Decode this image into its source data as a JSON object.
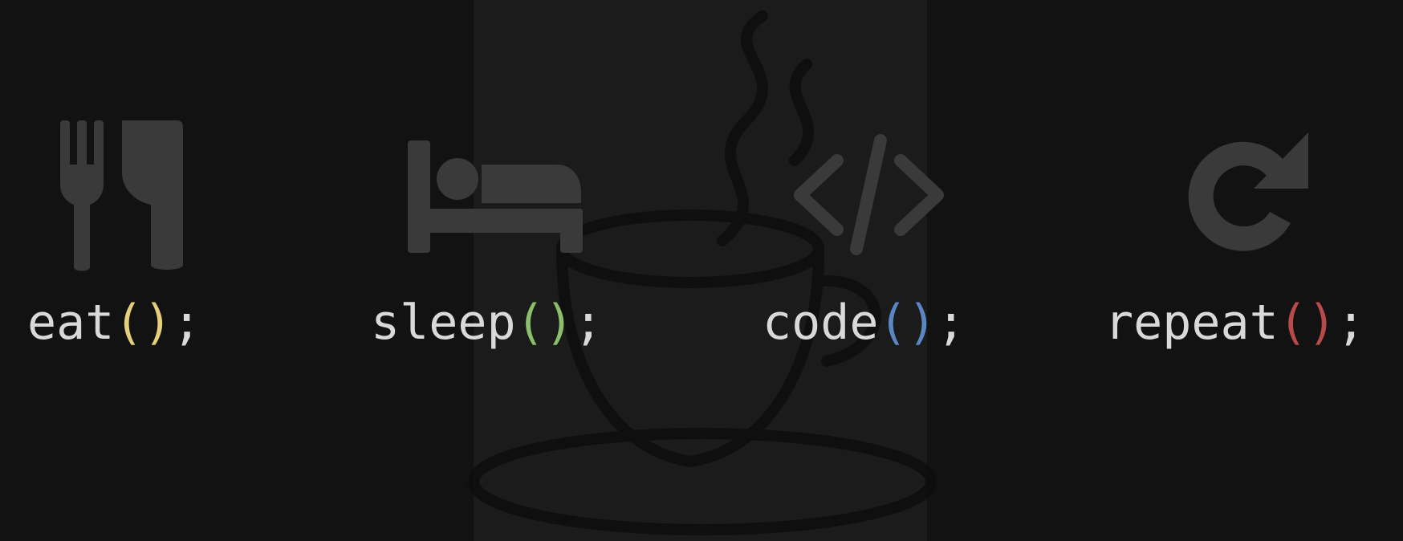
{
  "items": [
    {
      "name": "eat",
      "icon": "fork-knife-icon",
      "open": "(",
      "close": ")",
      "semicolon": ";",
      "paren_color": "#e4cf7a"
    },
    {
      "name": "sleep",
      "icon": "bed-icon",
      "open": "(",
      "close": ")",
      "semicolon": ";",
      "paren_color": "#8cbf6a"
    },
    {
      "name": "code",
      "icon": "code-brackets-icon",
      "open": "(",
      "close": ")",
      "semicolon": ";",
      "paren_color": "#5b86c4"
    },
    {
      "name": "repeat",
      "icon": "refresh-icon",
      "open": "(",
      "close": ")",
      "semicolon": ";",
      "paren_color": "#b84a4a"
    }
  ],
  "background_logo": "coffee-cup-icon",
  "colors": {
    "background": "#121212",
    "center_band": "#1b1b1b",
    "icon": "#3a3a3a",
    "text": "#d9d9d9",
    "logo_stroke": "#0c0c0c"
  }
}
